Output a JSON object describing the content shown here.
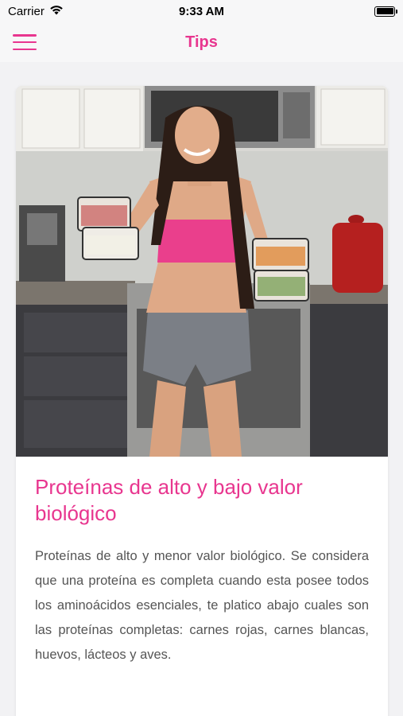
{
  "status_bar": {
    "carrier": "Carrier",
    "time": "9:33 AM"
  },
  "nav": {
    "title": "Tips",
    "menu_icon": "hamburger-menu-icon"
  },
  "article": {
    "image_alt": "Woman in pink sports top holding meal prep containers in a kitchen",
    "title": "Proteínas de alto y bajo valor biológico",
    "body": "Proteínas de alto y menor valor biológico. Se considera que una proteína es completa cuando esta posee todos los aminoácidos esenciales, te platico abajo cuales son las proteínas completas: carnes rojas, carnes blancas, huevos, lácteos y aves."
  },
  "colors": {
    "accent": "#e8368f",
    "background": "#f2f2f4",
    "card": "#ffffff",
    "body_text": "#555555"
  }
}
